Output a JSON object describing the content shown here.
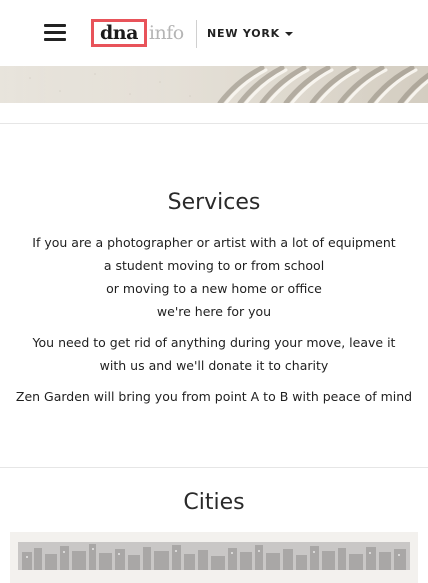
{
  "header": {
    "logo_primary": "dna",
    "logo_secondary": "info",
    "city_label": "NEW YORK"
  },
  "services": {
    "title": "Services",
    "lines_1": [
      "If you are a photographer or artist with a lot of equipment",
      "a student moving to or from school",
      "or moving to a new home or office",
      "we're here for you"
    ],
    "line_2": "You need to get rid of anything during your move, leave it with us and we'll donate it to charity",
    "line_3": "Zen Garden will bring you from point A to B with peace of mind"
  },
  "cities": {
    "title": "Cities"
  },
  "colors": {
    "logo_accent": "#e8535a",
    "text": "#222222",
    "divider": "#e6e6e6"
  },
  "icons": {
    "menu": "hamburger-icon",
    "city_dropdown": "caret-down-icon"
  }
}
